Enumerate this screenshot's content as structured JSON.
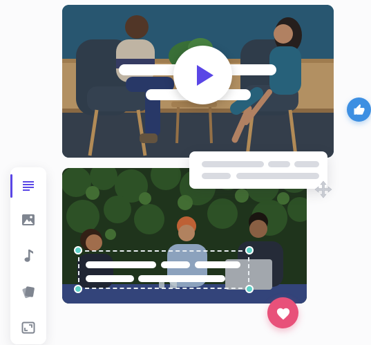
{
  "colors": {
    "accent": "#5a46e6",
    "like": "#3d8fe2",
    "heart": "#e8517a",
    "handle": "#5fd2c8",
    "pill": "#d9dbe1",
    "icon_inactive": "#7f8590"
  },
  "video": {
    "play_icon": "play-icon"
  },
  "toolbar": {
    "tools": [
      {
        "icon": "text-lines-icon",
        "active": true
      },
      {
        "icon": "image-icon",
        "active": false
      },
      {
        "icon": "music-note-icon",
        "active": false
      },
      {
        "icon": "sticker-icon",
        "active": false
      },
      {
        "icon": "resize-icon",
        "active": false
      }
    ]
  },
  "badges": {
    "like_icon": "thumbs-up-icon",
    "heart_icon": "heart-icon"
  }
}
